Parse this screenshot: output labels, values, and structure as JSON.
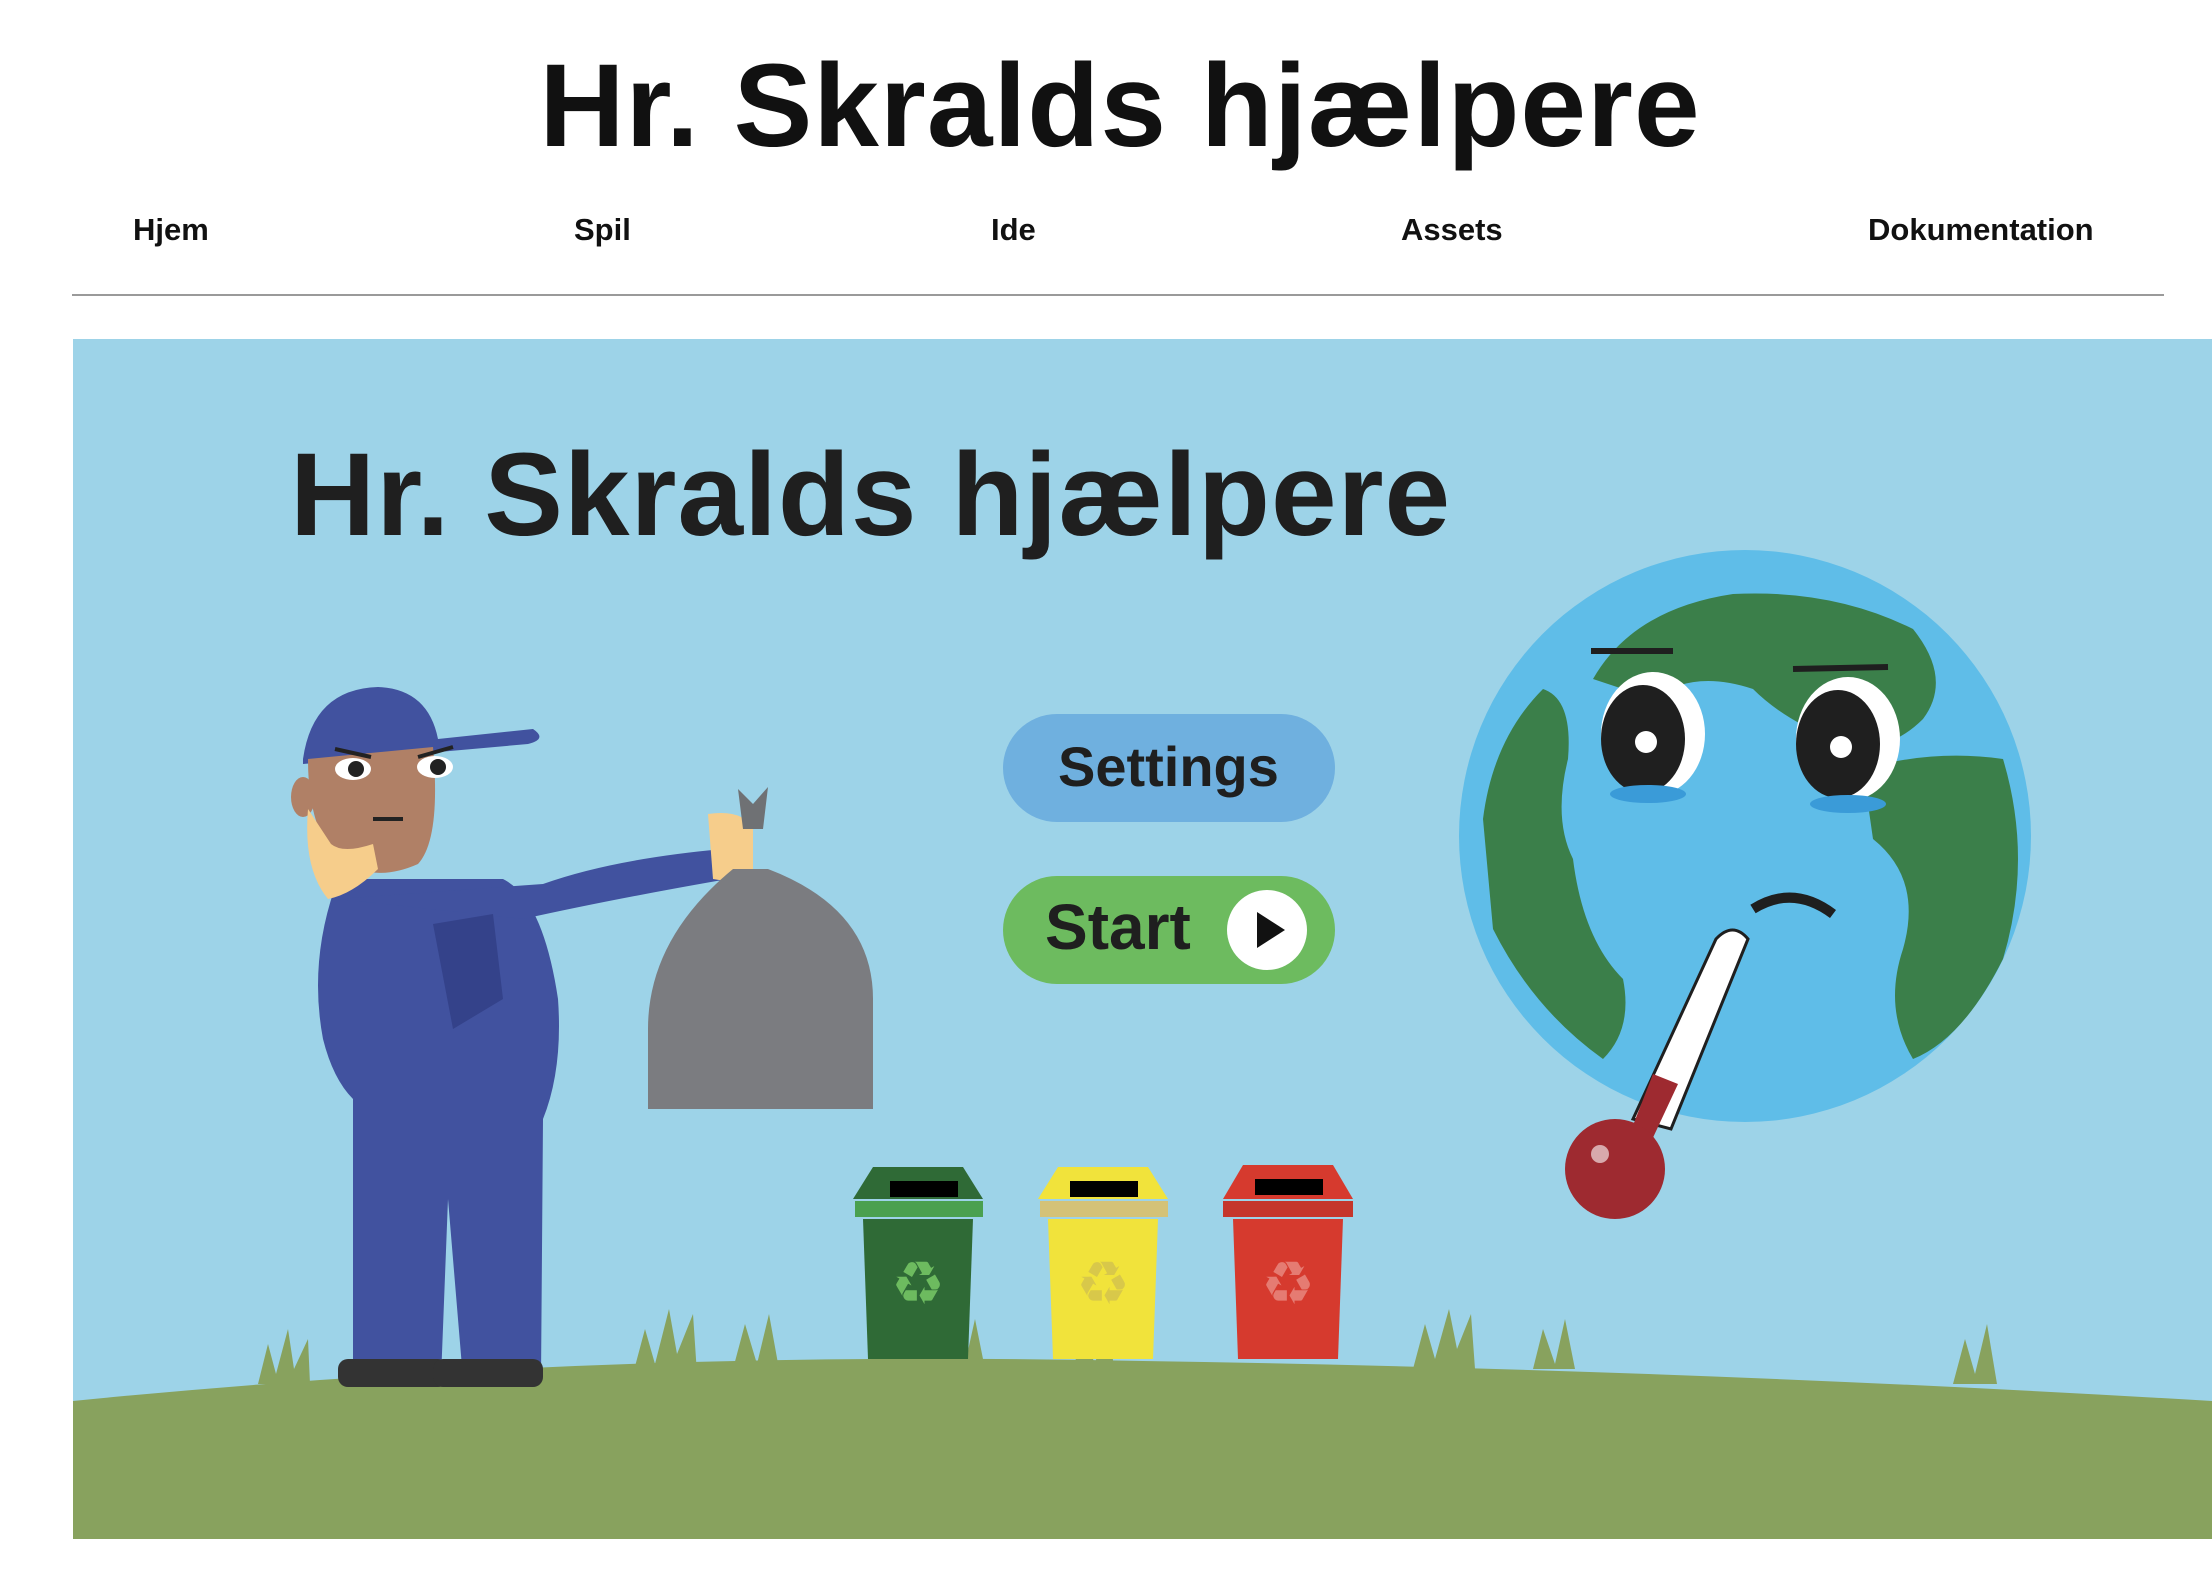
{
  "site": {
    "title": "Hr. Skralds hjælpere"
  },
  "nav": {
    "items": [
      "Hjem",
      "Spil",
      "Ide",
      "Assets",
      "Dokumentation"
    ]
  },
  "game": {
    "title": "Hr. Skralds hjælpere",
    "settings_label": "Settings",
    "start_label": "Start",
    "colors": {
      "sky": "#9dd3e8",
      "grass": "#88a25e",
      "settings": "#6fb0df",
      "start": "#6dbb5f"
    },
    "bins": [
      "green-recycling-bin",
      "yellow-recycling-bin",
      "red-recycling-bin"
    ],
    "icons": [
      "play-icon",
      "recycle-icon",
      "thermometer-icon"
    ]
  }
}
